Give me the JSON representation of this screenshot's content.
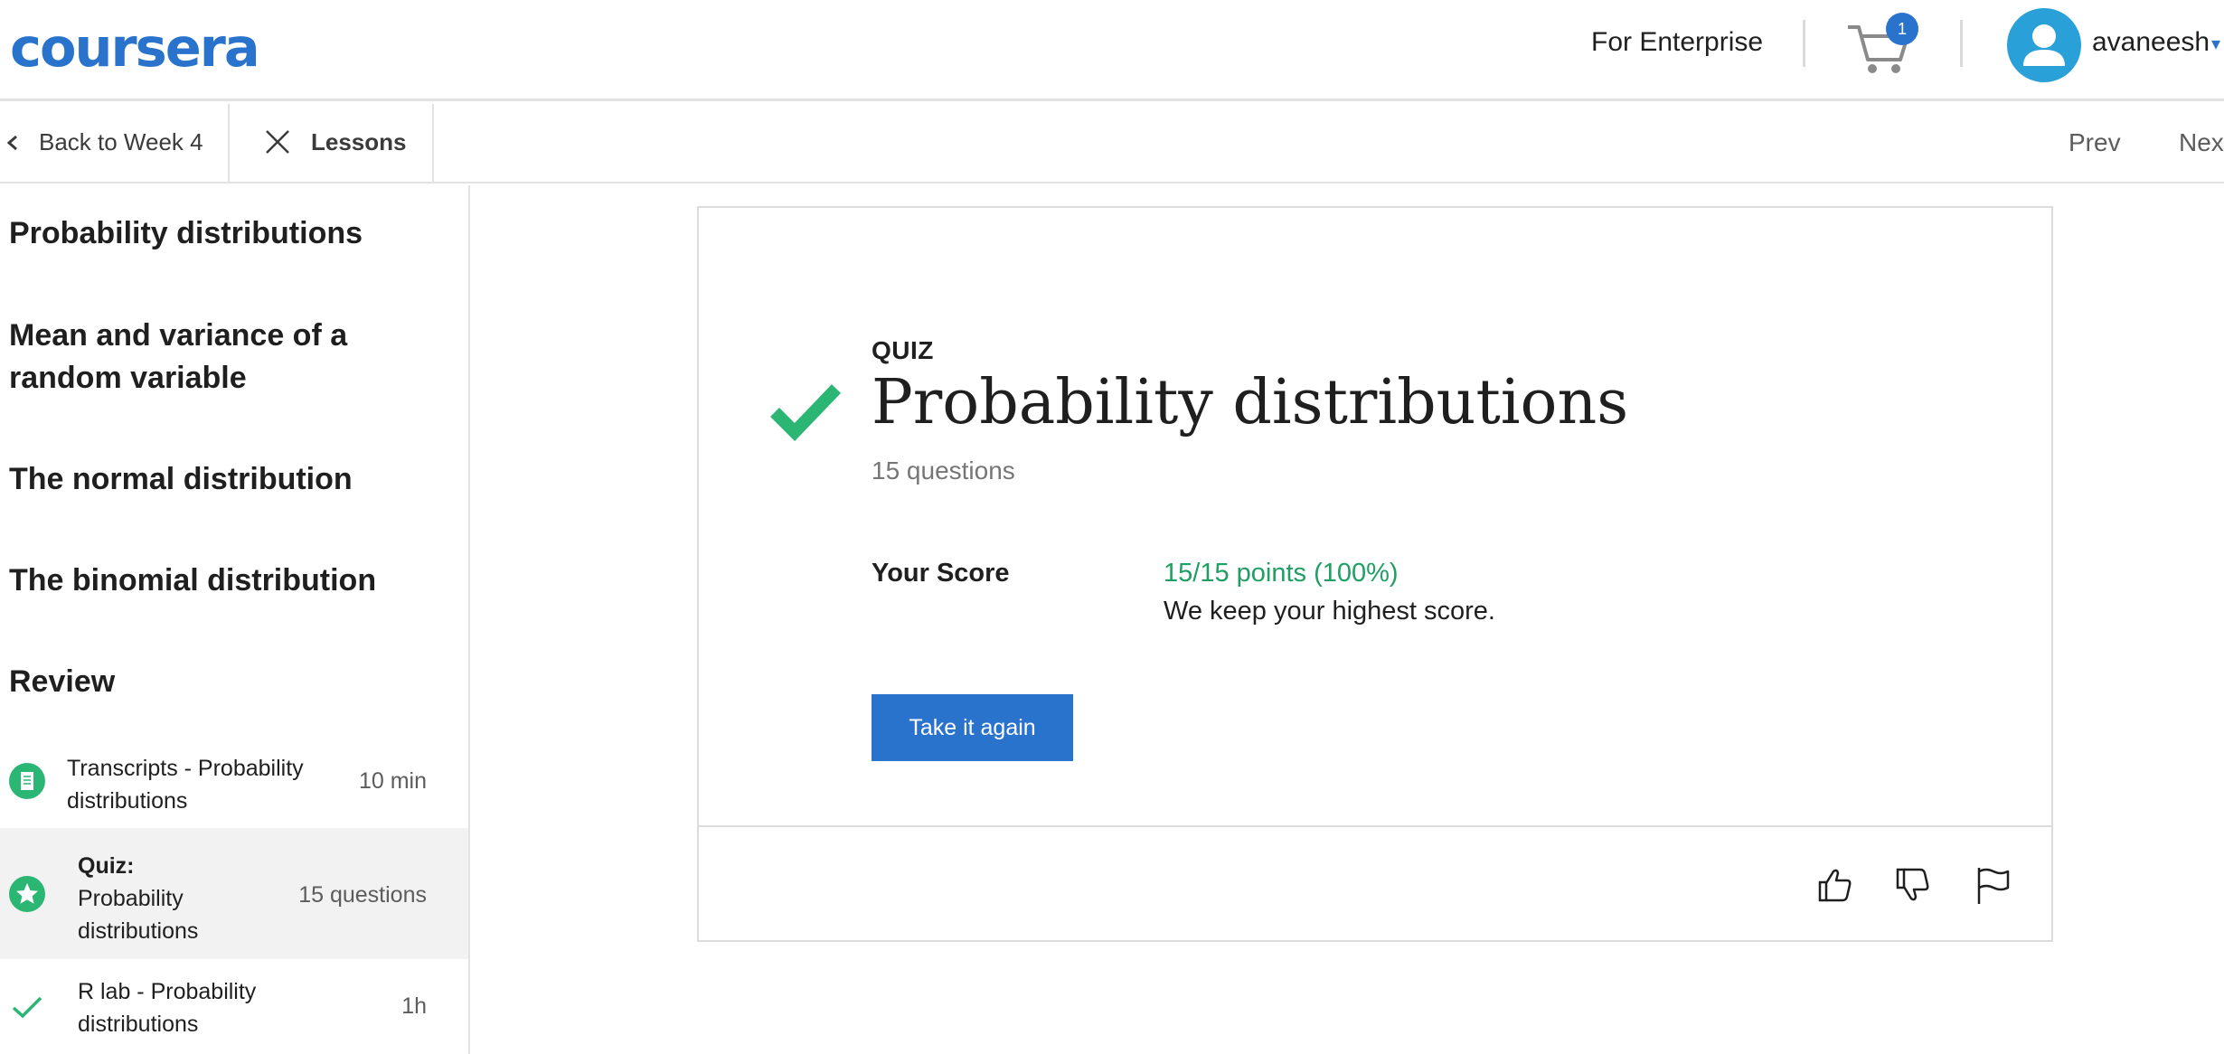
{
  "header": {
    "logo": "coursera",
    "enterprise_link": "For Enterprise",
    "cart_count": "1",
    "username": "avaneesh"
  },
  "subnav": {
    "back": "Back to Week 4",
    "lessons": "Lessons",
    "prev": "Prev",
    "next": "Next"
  },
  "sidebar": {
    "headings": [
      "Probability distributions",
      "Mean and variance of a random variable",
      "The normal distribution",
      "The binomial distribution",
      "Review"
    ],
    "items": [
      {
        "label": "Transcripts - Probability distributions",
        "meta": "10 min",
        "icon": "reading-icon",
        "active": false
      },
      {
        "prefix": "Quiz:",
        "label": "Probability distributions",
        "meta": "15 questions",
        "icon": "quiz-star-icon",
        "active": true
      },
      {
        "label": "R lab - Probability distributions",
        "meta": "1h",
        "icon": "check-icon",
        "active": false
      }
    ]
  },
  "quiz": {
    "kicker": "QUIZ",
    "title": "Probability distributions",
    "count": "15 questions",
    "score_label": "Your Score",
    "score_value": "15/15 points (100%)",
    "score_note": "We keep your highest score.",
    "retake_button": "Take it again"
  },
  "feedback": {
    "icons": [
      "thumbs-up-icon",
      "thumbs-down-icon",
      "flag-icon"
    ]
  },
  "colors": {
    "brand": "#2a73cc",
    "success": "#2bb673",
    "score_text": "#1f9f63"
  }
}
